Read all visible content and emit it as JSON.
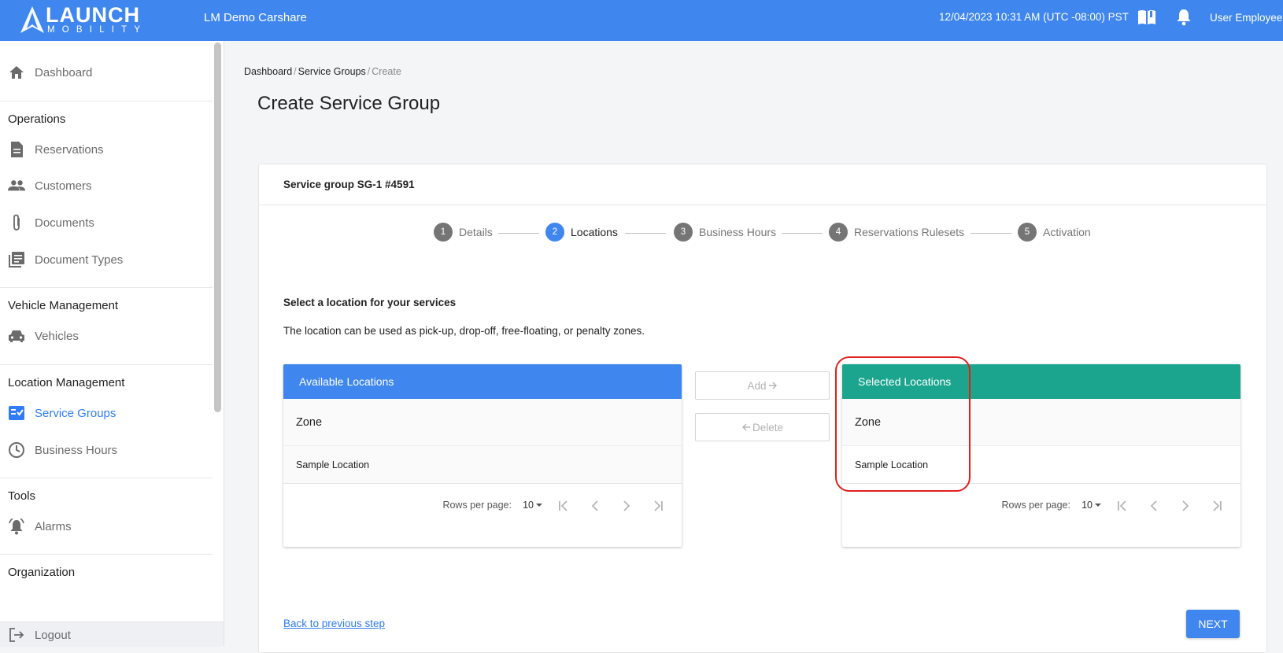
{
  "header": {
    "logo_word": "LAUNCH",
    "logo_sub": "MOBILITY",
    "app_name": "LM Demo Carshare",
    "datetime": "12/04/2023 10:31 AM (UTC -08:00) PST",
    "user_name": "User Employee",
    "color": "#3f86ee"
  },
  "sidebar": {
    "dashboard": "Dashboard",
    "sections": {
      "operations": "Operations",
      "vehicle_management": "Vehicle Management",
      "location_management": "Location Management",
      "tools": "Tools",
      "organization": "Organization"
    },
    "items": {
      "reservations": "Reservations",
      "customers": "Customers",
      "documents": "Documents",
      "document_types": "Document Types",
      "vehicles": "Vehicles",
      "service_groups": "Service Groups",
      "business_hours": "Business Hours",
      "alarms": "Alarms"
    },
    "logout": "Logout",
    "active_color": "#2f7cf6"
  },
  "breadcrumb": {
    "items": [
      "Dashboard",
      "Service Groups"
    ],
    "current": "Create",
    "separator": "/"
  },
  "page_title": "Create Service Group",
  "card": {
    "title": "Service group SG-1 #4591",
    "steps": [
      {
        "num": "1",
        "label": "Details"
      },
      {
        "num": "2",
        "label": "Locations"
      },
      {
        "num": "3",
        "label": "Business Hours"
      },
      {
        "num": "4",
        "label": "Reservations Rulesets"
      },
      {
        "num": "5",
        "label": "Activation"
      }
    ],
    "active_step": 2,
    "section_heading": "Select a location for your services",
    "section_text": "The location can be used as pick-up, drop-off, free-floating, or penalty zones."
  },
  "available": {
    "title": "Available Locations",
    "column": "Zone",
    "rows": [
      "Sample Location"
    ],
    "rows_per_page_label": "Rows per page:",
    "rows_per_page": "10",
    "color": "#3f86ee"
  },
  "selected": {
    "title": "Selected Locations",
    "column": "Zone",
    "rows": [
      "Sample Location"
    ],
    "rows_per_page_label": "Rows per page:",
    "rows_per_page": "10",
    "color": "#1ba58e"
  },
  "transfer": {
    "add_label": "Add",
    "delete_label": "Delete"
  },
  "footer": {
    "back_label": "Back to previous step",
    "next_label": "NEXT"
  }
}
